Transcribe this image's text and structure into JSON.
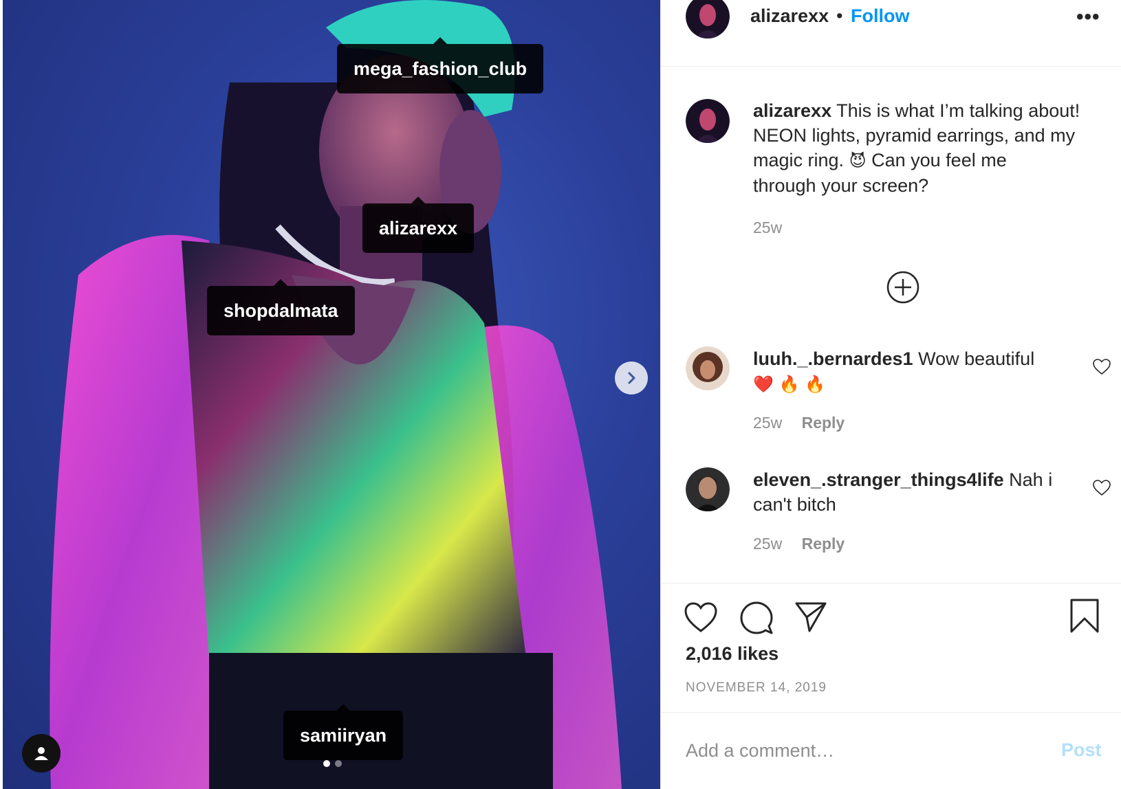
{
  "photo": {
    "tags": [
      "mega_fashion_club",
      "alizarexx",
      "shopdalmata",
      "samiiryan"
    ],
    "carousel_dots": 2,
    "active_dot": 0,
    "next_icon": "chevron-right-icon",
    "user_tag_icon": "person-icon"
  },
  "header": {
    "username": "alizarexx",
    "separator": "•",
    "follow_label": "Follow",
    "more_label": "•••"
  },
  "caption": {
    "username": "alizarexx",
    "line1": "This is what I’m talking about!",
    "line2": "NEON lights, pyramid earrings, and my",
    "line3_before": "magic ring.",
    "line3_emoji": "😈",
    "line3_after": "Can you feel me",
    "line4": "through your screen?",
    "age": "25w"
  },
  "comments": [
    {
      "username": "luuh._.bernardes1",
      "text": "Wow beautiful",
      "emojis": "❤️ 🔥 🔥",
      "age": "25w",
      "reply_label": "Reply"
    },
    {
      "username": "eleven_.stranger_things4life",
      "text_line1": "Nah i",
      "text_line2": "can't bitch",
      "age": "25w",
      "reply_label": "Reply"
    }
  ],
  "footer": {
    "likes": "2,016 likes",
    "date": "NOVEMBER 14, 2019",
    "comment_placeholder": "Add a comment…",
    "post_label": "Post"
  },
  "colors": {
    "link_blue": "#0095f6",
    "post_disabled": "#b2dffc",
    "muted": "#8e8e8e",
    "text": "#262626"
  }
}
